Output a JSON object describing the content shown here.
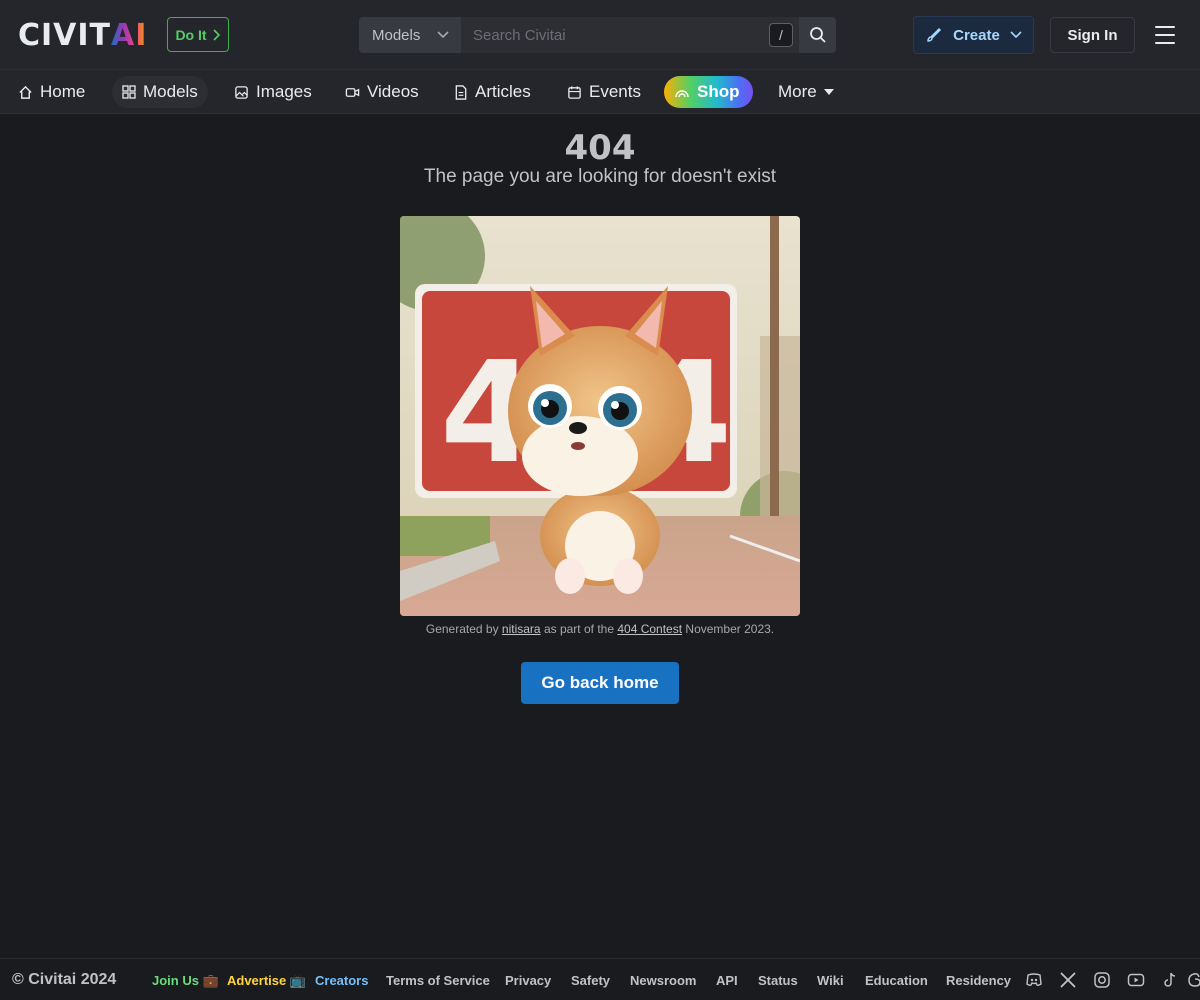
{
  "header": {
    "logo_part1": "CIVIT",
    "logo_part2": "AI",
    "doit_label": "Do It",
    "search_scope": "Models",
    "search_placeholder": "Search Civitai",
    "search_shortcut": "/",
    "create_label": "Create",
    "signin_label": "Sign In"
  },
  "nav": {
    "items": [
      {
        "label": "Home",
        "icon": "home-icon"
      },
      {
        "label": "Models",
        "icon": "grid-icon"
      },
      {
        "label": "Images",
        "icon": "photo-icon"
      },
      {
        "label": "Videos",
        "icon": "video-icon"
      },
      {
        "label": "Articles",
        "icon": "file-text-icon"
      },
      {
        "label": "Events",
        "icon": "calendar-icon"
      },
      {
        "label": "Shop",
        "icon": "rainbow-icon"
      },
      {
        "label": "More",
        "icon": "caret-down-icon"
      }
    ],
    "active": "Models"
  },
  "main": {
    "error_code": "404",
    "message": "The page you are looking for doesn't exist",
    "image_sign_text": "404",
    "caption_prefix": "Generated by",
    "caption_author": "nitisara",
    "caption_middle": "as part of the",
    "caption_contest": "404 Contest",
    "caption_suffix": "November 2023.",
    "home_button": "Go back home"
  },
  "footer": {
    "copyright": "© Civitai 2024",
    "links": [
      {
        "label": "Join Us 💼",
        "color": "#69db7c"
      },
      {
        "label": "Advertise 📺",
        "color": "#ffd43b"
      },
      {
        "label": "Creators",
        "color": "#74c0fc"
      },
      {
        "label": "Terms of Service",
        "color": "#c1c2c5"
      },
      {
        "label": "Privacy",
        "color": "#c1c2c5"
      },
      {
        "label": "Safety",
        "color": "#c1c2c5"
      },
      {
        "label": "Newsroom",
        "color": "#c1c2c5"
      },
      {
        "label": "API",
        "color": "#c1c2c5"
      },
      {
        "label": "Status",
        "color": "#c1c2c5"
      },
      {
        "label": "Wiki",
        "color": "#c1c2c5"
      },
      {
        "label": "Education",
        "color": "#c1c2c5"
      },
      {
        "label": "Residency",
        "color": "#c1c2c5"
      }
    ],
    "social_icons": [
      "discord-icon",
      "x-icon",
      "instagram-icon",
      "youtube-icon",
      "tiktok-icon",
      "threads-icon"
    ]
  },
  "colors": {
    "background": "#1a1b1e",
    "header": "#25262b",
    "primary_button": "#1971c2",
    "doit_border": "#37b24d"
  }
}
